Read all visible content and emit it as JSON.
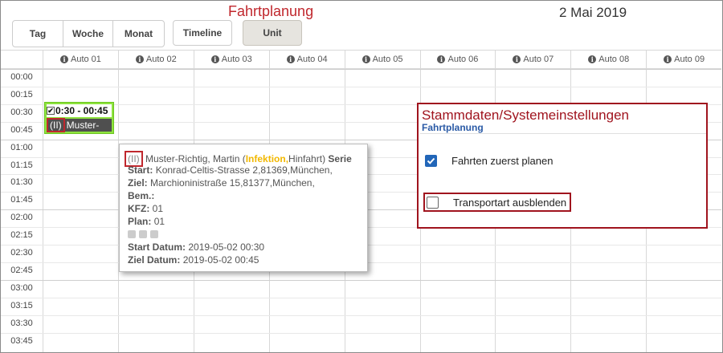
{
  "header": {
    "title": "Fahrtplanung",
    "date": "2 Mai 2019"
  },
  "view_buttons": [
    {
      "label": "Tag"
    },
    {
      "label": "Woche"
    },
    {
      "label": "Monat"
    }
  ],
  "timeline_label": "Timeline",
  "unit_label": "Unit",
  "columns": [
    "Auto 01",
    "Auto 02",
    "Auto 03",
    "Auto 04",
    "Auto 05",
    "Auto 06",
    "Auto 07",
    "Auto 08",
    "Auto 09"
  ],
  "times": [
    "00:00",
    "00:15",
    "00:30",
    "00:45",
    "01:00",
    "01:15",
    "01:30",
    "01:45",
    "02:00",
    "02:15",
    "02:30",
    "02:45",
    "03:00",
    "03:15",
    "03:30",
    "03:45"
  ],
  "event": {
    "check": "✔",
    "time": "0:30 - 00:45",
    "code": "(II)",
    "name": "Muster-",
    "color": "#8ee33e"
  },
  "tooltip": {
    "code": "(II)",
    "name_pre": "Muster-Richtig, Martin (",
    "infektion": "Infektion,",
    "name_post": "Hinfahrt)",
    "serie": "Serie",
    "start_label": "Start:",
    "start_value": "Konrad-Celtis-Strasse 2,81369,München,",
    "ziel_label": "Ziel:",
    "ziel_value": "Marchioninistraße 15,81377,München,",
    "bem_label": "Bem.:",
    "kfz_label": "KFZ:",
    "kfz_value": "01",
    "plan_label": "Plan:",
    "plan_value": "01",
    "start_datum_label": "Start Datum:",
    "start_datum_value": "2019-05-02 00:30",
    "ziel_datum_label": "Ziel Datum:",
    "ziel_datum_value": "2019-05-02 00:45"
  },
  "settings": {
    "title": "Stammdaten/Systemeinstellungen",
    "subtitle": "Fahrtplanung",
    "options": [
      {
        "label": "Fahrten zuerst planen",
        "checked": true
      },
      {
        "label": "Transportart ausblenden",
        "checked": false
      }
    ]
  }
}
